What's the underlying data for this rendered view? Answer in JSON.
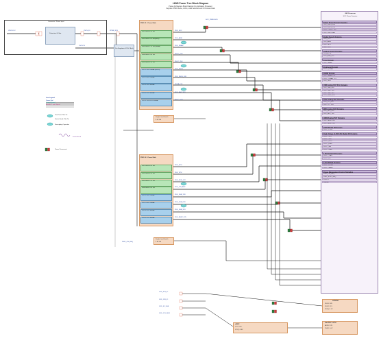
{
  "header": {
    "title": "i.MX8 Power Tree Block Diagram",
    "subtitle1": "Power Architecture Block Diagram for Application Processor",
    "subtitle2": "Supplies: PMIC Bucks, LDOs, Load Switches and I/O Domain Rails"
  },
  "connector": {
    "title": "Connector / Power Input",
    "input_label": "VIN 5V DC",
    "protect_label": "Protection & Filter",
    "vsys_label": "VSYS 5V"
  },
  "legend": {
    "title": "Line Legend",
    "items": [
      "Power Rail",
      "Control Signal",
      "Enable / Logic Signal"
    ],
    "symbol_items": [
      "Test Point / Net Tie",
      "Ferrite Bead / Net Tie",
      "Decoupling Capacitor"
    ],
    "fb_label": "Ferrite Bead",
    "pin_note": "Power Disconnect"
  },
  "dcdc": {
    "title": "Pre-Regulator DC/DC Buck",
    "output": "VPWR 3V3"
  },
  "pmic1": {
    "title": "PMIC #1 - Power Rails",
    "regs": [
      {
        "label": "SW1 Buck 0.9V 4A",
        "type": "green",
        "rail": "VDD_SOC"
      },
      {
        "label": "SW2 Buck 1.0V 4A (ARM)",
        "type": "green",
        "rail": "VDD_ARM"
      },
      {
        "label": "SW3 Buck 1.1V 2A (DRAM)",
        "type": "green",
        "rail": "VDD_DRAM"
      },
      {
        "label": "SW4 Buck 1.8V 2A",
        "type": "green",
        "rail": "NVCC_1V8"
      },
      {
        "label": "SW5 Buck 3.3V 2A",
        "type": "green",
        "rail": "NVCC_3V3"
      },
      {
        "label": "LDO1 1.8V 250mA (SNVS)",
        "type": "blue",
        "rail": "VDD_SNVS"
      },
      {
        "label": "LDO2 0.8V 250mA",
        "type": "blue",
        "rail": "VDD_SNVS_0V8"
      },
      {
        "label": "LDO3 1.8V 300mA",
        "type": "blue",
        "rail": "VDDA_1V8"
      },
      {
        "label": "LDO4 3.3V 300mA",
        "type": "blue",
        "rail": "VDD_PHY_3V3"
      },
      {
        "label": "LDO5 1.8V/3.3V 300mA",
        "type": "blue",
        "rail": "NVCC_SD2"
      }
    ],
    "enable_label": "PMIC_ON_REQ"
  },
  "pmic2": {
    "title": "PMIC #2 - Power Rails",
    "regs": [
      {
        "label": "SW1 Buck 0.8V 3A",
        "type": "green",
        "rail": "VDD_GPU"
      },
      {
        "label": "SW2 Buck 0.9V 3A",
        "type": "green",
        "rail": "VDD_VPU"
      },
      {
        "label": "SW3 Buck 1.2V 2A",
        "type": "green",
        "rail": "VDD_DDR_1V2"
      },
      {
        "label": "SW4 Buck 1.8V 1A",
        "type": "green",
        "rail": "VDD_1V8_AUX"
      },
      {
        "label": "LDO1 1.8V 150mA",
        "type": "blue",
        "rail": "VDD_USB_1V8"
      },
      {
        "label": "LDO2 0.8V 150mA",
        "type": "blue",
        "rail": "VDD_USB_0V8"
      },
      {
        "label": "LDO3 3.3V 300mA",
        "type": "blue",
        "rail": "VDD_USB_3V3"
      },
      {
        "label": "LDO4 2.5V 300mA",
        "type": "blue",
        "rail": "VDD_ENET_2V5"
      }
    ]
  },
  "load_switch1": {
    "title": "Single Load Switch",
    "sub": "3.3V 1A",
    "out": "VDD_3V3_SW"
  },
  "load_switch2": {
    "title": "Single Load Switch",
    "sub": "1.8V 1A",
    "out": "VDD_1V8_SW"
  },
  "soc": {
    "title": "i.MX Processor",
    "subtitle": "SOC Power Domains",
    "sections": [
      {
        "header": "Safety Power Domain Supplies",
        "rows": [
          "VDD_SNVS_0V8",
          "VDD_SNVS_1V8",
          "NVCC_SNVS_1V8",
          "VDD_SNVS_BAT"
        ]
      },
      {
        "header": "Digital Supply Domains",
        "rows": [
          "VDD_SOC",
          "VDD_ARM",
          "VDD_GPU",
          "VDD_VPU"
        ]
      },
      {
        "header": "Analog Supply Domains",
        "rows": [
          "VDDA_1V8",
          "VDD_ANA_0V8"
        ]
      },
      {
        "header": "Core Domain",
        "rows": [
          "VDD_DRAM"
        ]
      },
      {
        "header": "Peripheral Domain",
        "rows": [
          "NVCC_DRAM"
        ]
      },
      {
        "header": "DRAM Domain",
        "rows": [
          "VDD_DRAM_PLL",
          "NVCC_DRAM_1V1",
          "VDD_DDR"
        ]
      },
      {
        "header": "USB Analog PHY PLL Domains",
        "rows": [
          "VDD_USB_0V8",
          "VDD_USB_1V8",
          "VDD_USB_3V3",
          "VDD_USB2_3V3"
        ]
      },
      {
        "header": "PCIe Analog PHY Domains",
        "rows": [
          "VDD_PCI_0V8",
          "VDD_PCI_1V8"
        ]
      },
      {
        "header": "MIPI Analog PHY Domains",
        "rows": [
          "VDD_MIPI_0V8",
          "VDD_MIPI_1V8"
        ]
      },
      {
        "header": "HDMI Analog PHY Domains",
        "rows": [
          "VDD_HDMI_0V8",
          "VDD_HDMI_1V8"
        ]
      },
      {
        "header": "LVDS Digital I/O Domain",
        "rows": [
          "NVCC_LVDS"
        ]
      },
      {
        "header": "Dual Voltage (1.8V/3.3V) Digital I/O Domains",
        "rows": [
          "NVCC_SD1",
          "NVCC_SD2",
          "NVCC_GPIO",
          "NVCC_ENET",
          "NVCC_SAI",
          "NVCC_UART"
        ]
      },
      {
        "header": "1.8V Digital I/O Domains",
        "rows": [
          "NVCC_JTAG",
          "NVCC_I2C"
        ]
      },
      {
        "header": "3.3V SPI/SAI Domains",
        "rows": [
          "NVCC_ECSPI",
          "NVCC_NAND"
        ]
      },
      {
        "header": "Power Management Control Signaling",
        "rows": [
          "PMIC_ON_REQ",
          "PMIC_STBY_REQ",
          "POR_B",
          "ONOFF"
        ]
      }
    ]
  },
  "bottom": {
    "lpddr": {
      "title": "LPDDR4",
      "lines": [
        "VDD1 1.8V",
        "VDD2 1.1V",
        "VDDQ 1.1V"
      ]
    },
    "emmc": {
      "title": "eMMC",
      "lines": [
        "VCC 3.3V",
        "VCCQ 1.8V"
      ]
    },
    "phy": {
      "title": "Gbit PHY & ETH",
      "lines": [
        "AVDD 3.3V",
        "DVDD 1.0V"
      ]
    },
    "left_nets": [
      "VDD_3V3_IO",
      "VDD_1V8_IO",
      "VDD_5V_USB",
      "VDD_1V1_DDR"
    ]
  },
  "net_labels": {
    "vsys": "VSYS_5V",
    "vpwr": "VPWR_3V3",
    "pmic_on": "PMIC_ON_REQ",
    "soc_pwr": "SOC_PWRGOOD"
  }
}
